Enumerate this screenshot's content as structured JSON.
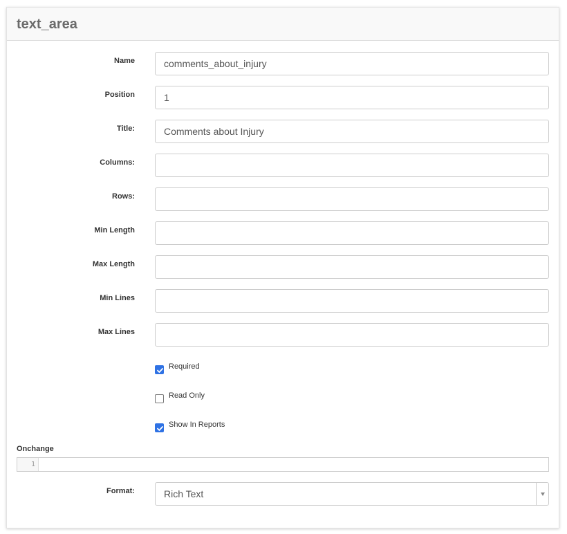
{
  "panel": {
    "title": "text_area"
  },
  "fields": {
    "name": {
      "label": "Name",
      "value": "comments_about_injury"
    },
    "position": {
      "label": "Position",
      "value": "1"
    },
    "title": {
      "label": "Title:",
      "value": "Comments about Injury"
    },
    "columns": {
      "label": "Columns:",
      "value": ""
    },
    "rows": {
      "label": "Rows:",
      "value": ""
    },
    "min_length": {
      "label": "Min Length",
      "value": ""
    },
    "max_length": {
      "label": "Max Length",
      "value": ""
    },
    "min_lines": {
      "label": "Min Lines",
      "value": ""
    },
    "max_lines": {
      "label": "Max Lines",
      "value": ""
    }
  },
  "checkboxes": {
    "required": {
      "label": "Required",
      "checked": true
    },
    "read_only": {
      "label": "Read Only",
      "checked": false
    },
    "show_in_reports": {
      "label": "Show In Reports",
      "checked": true
    }
  },
  "onchange": {
    "label": "Onchange",
    "line_number": "1"
  },
  "format": {
    "label": "Format:",
    "selected": "Rich Text"
  },
  "colors": {
    "checkbox_accent": "#2f72e4",
    "title_text": "#6b6b6b"
  }
}
